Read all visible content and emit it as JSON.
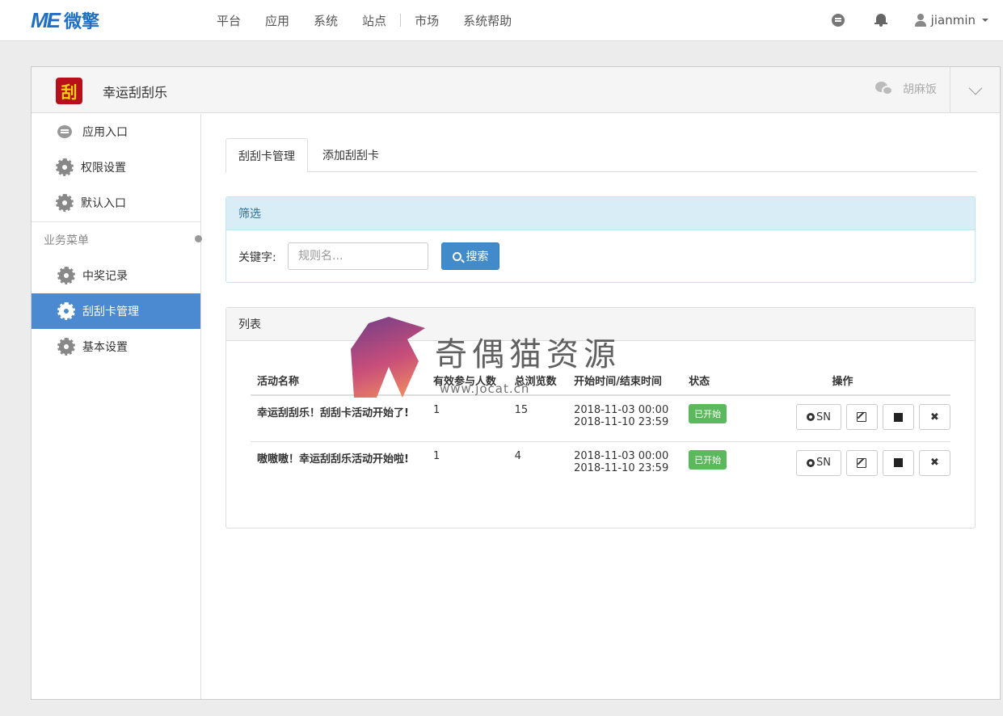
{
  "topbar": {
    "logo_mark": "ME",
    "logo_text": "微擎",
    "nav": [
      "平台",
      "应用",
      "系统",
      "站点",
      "市场",
      "系统帮助"
    ],
    "user": "jianmin"
  },
  "app": {
    "icon_glyph": "刮",
    "title": "幸运刮刮乐",
    "account": "胡麻饭"
  },
  "sidebar": {
    "top_items": [
      {
        "label": "应用入口",
        "icon": "message-icon"
      },
      {
        "label": "权限设置",
        "icon": "gear-icon"
      },
      {
        "label": "默认入口",
        "icon": "gear-icon"
      }
    ],
    "group_label": "业务菜单",
    "business_items": [
      {
        "label": "中奖记录",
        "icon": "gear-icon",
        "active": false
      },
      {
        "label": "刮刮卡管理",
        "icon": "gear-icon",
        "active": true
      },
      {
        "label": "基本设置",
        "icon": "gear-icon",
        "active": false
      }
    ]
  },
  "tabs": [
    {
      "label": "刮刮卡管理",
      "active": true
    },
    {
      "label": "添加刮刮卡",
      "active": false
    }
  ],
  "filter": {
    "title": "筛选",
    "keyword_label": "关键字:",
    "keyword_placeholder": "规则名...",
    "keyword_value": "",
    "search_label": "搜索"
  },
  "list": {
    "title": "列表",
    "columns": [
      "活动名称",
      "有效参与人数",
      "总浏览数",
      "开始时间/结束时间",
      "状态",
      "操作"
    ],
    "rows": [
      {
        "name": "幸运刮刮乐！刮刮卡活动开始了!",
        "participants": "1",
        "views": "15",
        "start": "2018-11-03 00:00",
        "end": "2018-11-10 23:59",
        "status": "已开始"
      },
      {
        "name": "嗷嗷嗷！幸运刮刮乐活动开始啦!",
        "participants": "1",
        "views": "4",
        "start": "2018-11-03 00:00",
        "end": "2018-11-10 23:59",
        "status": "已开始"
      }
    ],
    "op_sn_label": "SN"
  },
  "watermark": {
    "text": "奇偶猫资源",
    "url": "www.jocat.cn"
  },
  "colors": {
    "brand": "#1f6fc4",
    "active_sidebar": "#4b8ad0",
    "primary_button": "#428bca",
    "status_started": "#5cb85c",
    "info_panel": "#d9edf7"
  }
}
